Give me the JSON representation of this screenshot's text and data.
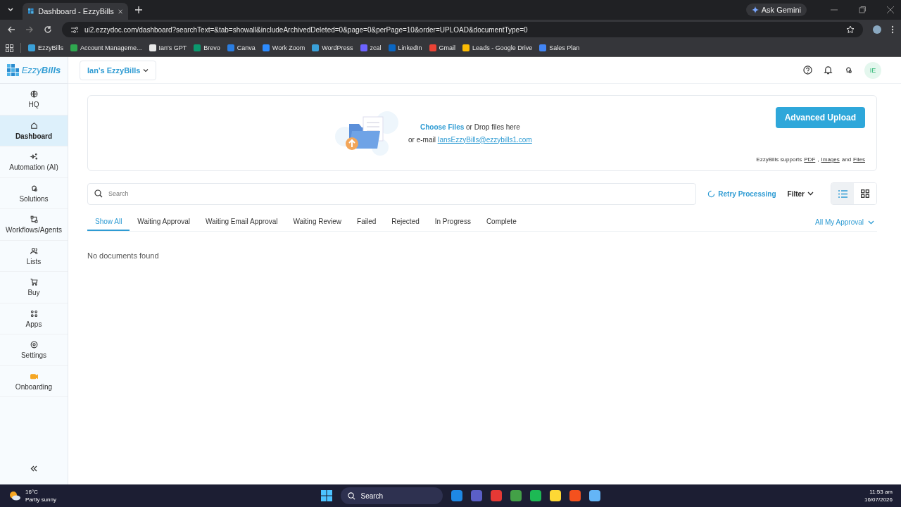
{
  "browser": {
    "tab_title": "Dashboard - EzzyBills",
    "url": "ui2.ezzydoc.com/dashboard?searchText=&tab=showall&includeArchivedDeleted=0&page=0&perPage=10&order=UPLOAD&documentType=0",
    "ask_gemini": "Ask Gemini",
    "bookmarks": [
      {
        "label": "EzzyBills",
        "color": "#3aa0d8"
      },
      {
        "label": "Account Manageme...",
        "color": "#2fa84f"
      },
      {
        "label": "Ian's GPT",
        "color": "#e8e8e8"
      },
      {
        "label": "Brevo",
        "color": "#0b996e"
      },
      {
        "label": "Canva",
        "color": "#2a7de1"
      },
      {
        "label": "Work Zoom",
        "color": "#2d8cff"
      },
      {
        "label": "WordPress",
        "color": "#3aa0d8"
      },
      {
        "label": "zcal",
        "color": "#6c63ff"
      },
      {
        "label": "LinkedIn",
        "color": "#0a66c2"
      },
      {
        "label": "Gmail",
        "color": "#ea4335"
      },
      {
        "label": "Leads - Google Drive",
        "color": "#fbbc04"
      },
      {
        "label": "Sales Plan",
        "color": "#4285f4"
      }
    ]
  },
  "app": {
    "brand": "Ezzy**Bills**",
    "workspace": "Ian's EzzyBills",
    "avatar": "IE",
    "sidebar": {
      "items": [
        {
          "label": "HQ",
          "selected": false
        },
        {
          "label": "Dashboard",
          "selected": true
        },
        {
          "label": "Automation (AI)",
          "selected": false
        },
        {
          "label": "Solutions",
          "selected": false
        },
        {
          "label": "Workflows/Agents",
          "selected": false
        },
        {
          "label": "Lists",
          "selected": false
        },
        {
          "label": "Buy",
          "selected": false
        },
        {
          "label": "Apps",
          "selected": false
        },
        {
          "label": "Settings",
          "selected": false
        },
        {
          "label": "Onboarding",
          "selected": false
        }
      ]
    },
    "upload": {
      "choose_files": "Choose Files",
      "drop_text": "or Drop files here",
      "email_prefix": "or e-mail",
      "email": "IansEzzyBills@ezzybills1.com",
      "button": "Advanced Upload",
      "supports": [
        {
          "text": "EzzyBills supports",
          "link": false
        },
        {
          "text": "PDF",
          "link": true
        },
        {
          "text": ",",
          "link": false
        },
        {
          "text": "Images",
          "link": true
        },
        {
          "text": "and",
          "link": false
        },
        {
          "text": "Files",
          "link": true
        }
      ]
    },
    "search": {
      "placeholder": "Search"
    },
    "retry": "Retry Processing",
    "filter": "Filter",
    "views": [
      {
        "selected": true
      },
      {
        "selected": false
      }
    ],
    "tabs": [
      {
        "label": "Show All",
        "selected": true
      },
      {
        "label": "Waiting Approval",
        "selected": false
      },
      {
        "label": "Waiting Email Approval",
        "selected": false
      },
      {
        "label": "Waiting Review",
        "selected": false
      },
      {
        "label": "Failed",
        "selected": false
      },
      {
        "label": "Rejected",
        "selected": false
      },
      {
        "label": "In Progress",
        "selected": false
      },
      {
        "label": "Complete",
        "selected": false
      }
    ],
    "approval_filter": "All My Approval",
    "empty": "No documents found"
  },
  "taskbar": {
    "temperature": "16°C",
    "weather": "Partly sunny",
    "search": "Search",
    "time": "11:53 am",
    "date": "16/07/2026",
    "apps": [
      {
        "color": "#1e88e5"
      },
      {
        "color": "#5b5fc7"
      },
      {
        "color": "#e53935"
      },
      {
        "color": "#43a047"
      },
      {
        "color": "#1db954"
      },
      {
        "color": "#fdd835"
      },
      {
        "color": "#f4511e"
      },
      {
        "color": "#64b5f6"
      }
    ]
  }
}
